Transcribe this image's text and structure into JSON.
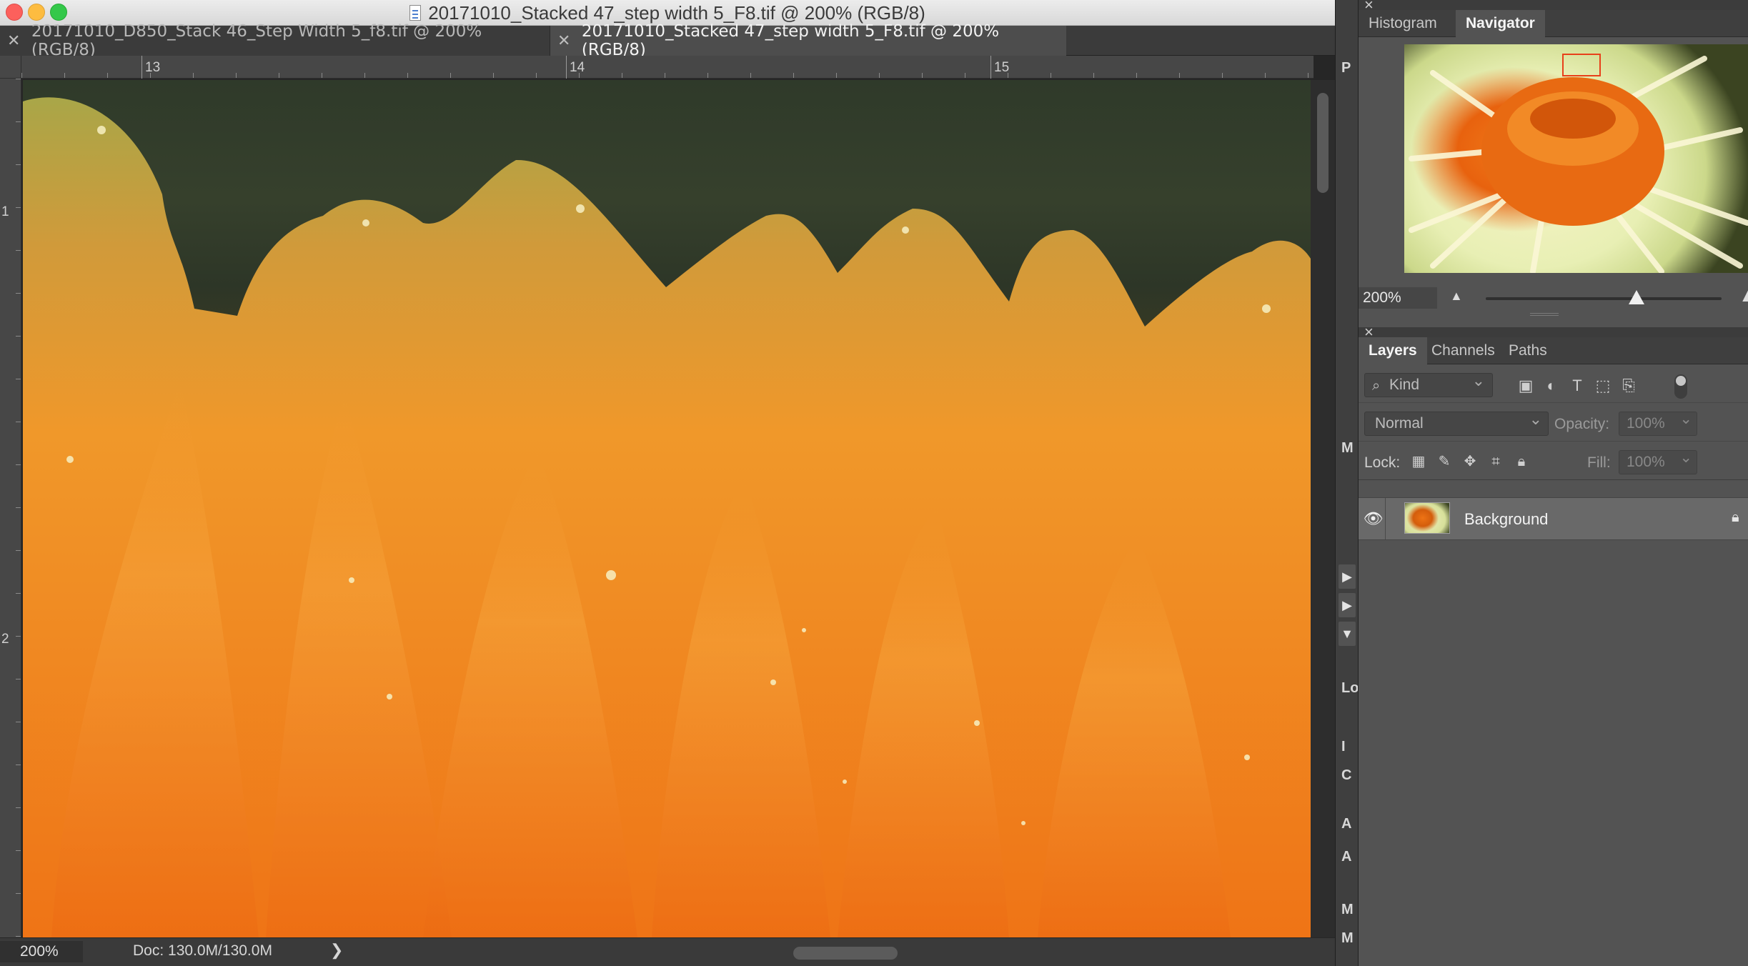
{
  "window": {
    "title": "20171010_Stacked 47_step width 5_F8.tif @ 200% (RGB/8)"
  },
  "tabs": [
    {
      "label": "20171010_D850_Stack 46_Step Width 5_f8.tif @ 200% (RGB/8)",
      "active": false
    },
    {
      "label": "20171010_Stacked 47_step width 5_F8.tif @ 200% (RGB/8)",
      "active": true
    }
  ],
  "rulers": {
    "horizontal_labels": [
      "13",
      "14",
      "15"
    ],
    "vertical_labels": [
      "1",
      "2"
    ]
  },
  "status": {
    "zoom": "200%",
    "doc": "Doc: 130.0M/130.0M",
    "arrow": "❯"
  },
  "mid_dock": {
    "letters": [
      "P",
      "M",
      "Lo",
      "I",
      "C",
      "A",
      "A",
      "M",
      "M"
    ]
  },
  "navigator_panel": {
    "tabs": [
      "Histogram",
      "Navigator"
    ],
    "active_tab": "Navigator",
    "zoom": "200%"
  },
  "layers_panel": {
    "tabs": [
      "Layers",
      "Channels",
      "Paths"
    ],
    "active_tab": "Layers",
    "kind_filter": "Kind",
    "blend_mode": "Normal",
    "opacity_label": "Opacity:",
    "opacity_value": "100%",
    "lock_label": "Lock:",
    "fill_label": "Fill:",
    "fill_value": "100%",
    "layers": [
      {
        "name": "Background",
        "visible": true,
        "locked": true
      }
    ]
  },
  "colors": {
    "panel_bg": "#535353",
    "canvas_orange": "#ee7d1c",
    "active_tab_text": "#f2f2f2"
  }
}
